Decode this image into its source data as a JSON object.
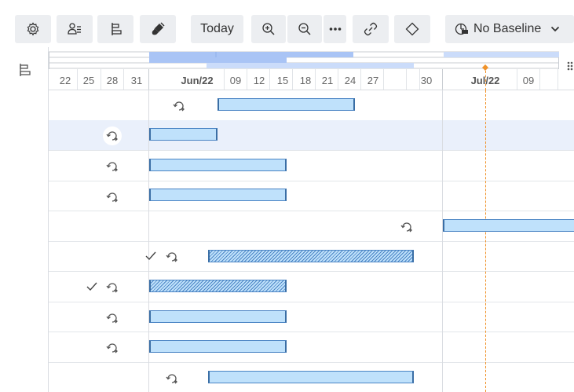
{
  "toolbar": {
    "today_label": "Today",
    "baseline_label": "No Baseline",
    "buttons": [
      "settings-icon",
      "assignees-icon",
      "grouping-icon",
      "paint-icon",
      "zoom-in-icon",
      "zoom-out-icon",
      "more-icon",
      "link-icon",
      "milestone-icon",
      "baseline-icon"
    ]
  },
  "timeline": {
    "dates": [
      {
        "label": "22",
        "major": false
      },
      {
        "label": "25",
        "major": false
      },
      {
        "label": "28",
        "major": false
      },
      {
        "label": "31",
        "major": false
      },
      {
        "label": "Jun/22",
        "major": true
      },
      {
        "label": "09",
        "major": false
      },
      {
        "label": "12",
        "major": false
      },
      {
        "label": "15",
        "major": false
      },
      {
        "label": "18",
        "major": false
      },
      {
        "label": "21",
        "major": false
      },
      {
        "label": "24",
        "major": false
      },
      {
        "label": "27",
        "major": false
      },
      {
        "label": "30",
        "major": false
      },
      {
        "label": "Jul/22",
        "major": true
      },
      {
        "label": "09",
        "major": false
      }
    ]
  },
  "rows": [
    {
      "selected": false,
      "done": false,
      "hatched": false
    },
    {
      "selected": true,
      "done": false,
      "hatched": false
    },
    {
      "selected": false,
      "done": false,
      "hatched": false
    },
    {
      "selected": false,
      "done": false,
      "hatched": false
    },
    {
      "selected": false,
      "done": false,
      "hatched": false
    },
    {
      "selected": false,
      "done": true,
      "hatched": true
    },
    {
      "selected": false,
      "done": true,
      "hatched": true
    },
    {
      "selected": false,
      "done": false,
      "hatched": false
    },
    {
      "selected": false,
      "done": false,
      "hatched": false
    },
    {
      "selected": false,
      "done": false,
      "hatched": false
    }
  ],
  "colors": {
    "bar_fill": "#bfe1fb",
    "bar_border": "#3a6ea5",
    "today_line": "#f0932b",
    "selected_row": "#eaf0fb",
    "overview_bar": "#a9c4f5"
  }
}
